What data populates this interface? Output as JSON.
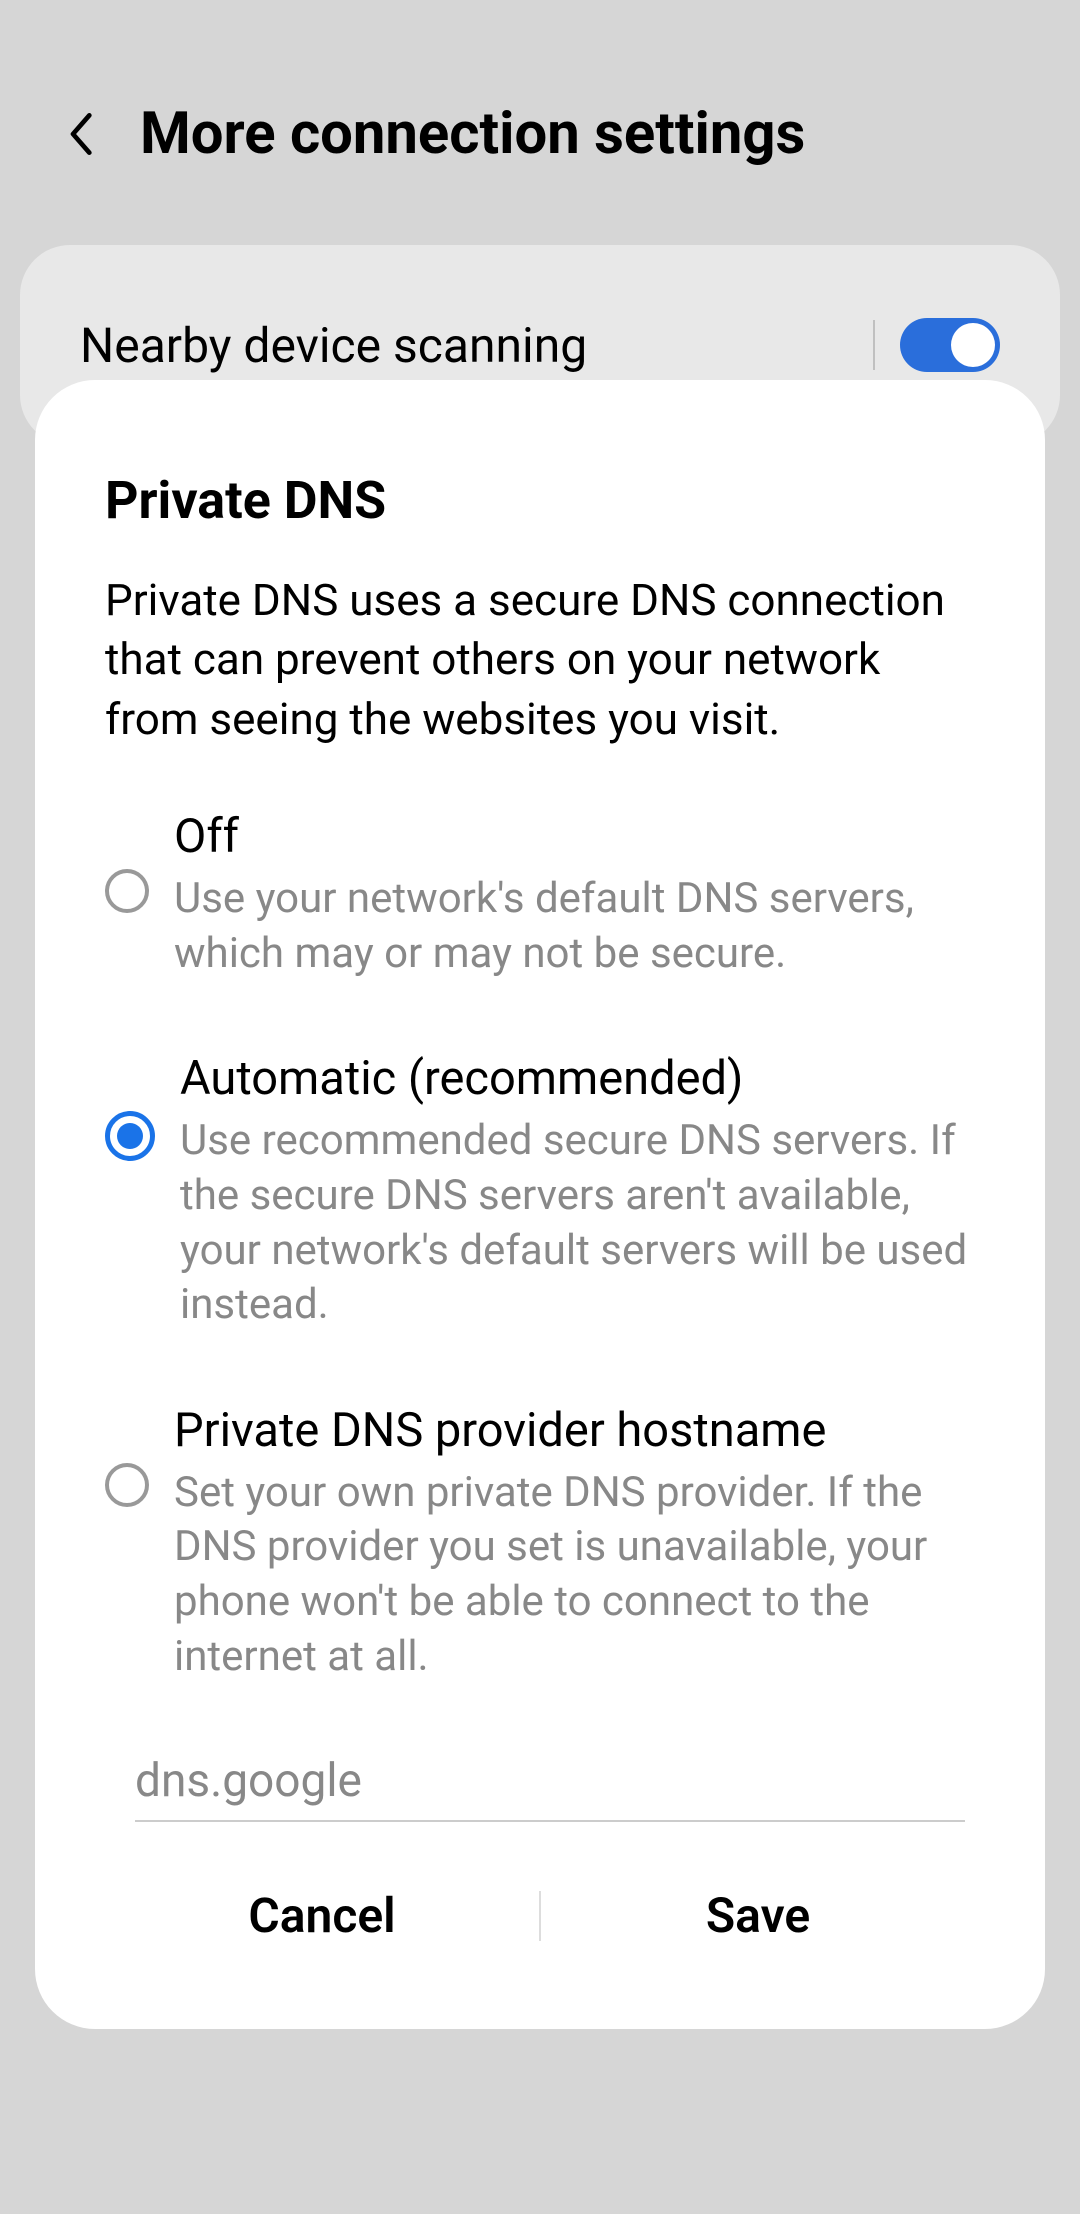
{
  "header": {
    "title": "More connection settings"
  },
  "nearby": {
    "label": "Nearby device scanning",
    "enabled": true
  },
  "dialog": {
    "title": "Private DNS",
    "description": "Private DNS uses a secure DNS connection that can prevent others on your network from seeing the websites you visit.",
    "options": [
      {
        "title": "Off",
        "description": "Use your network's default DNS servers, which may or may not be secure.",
        "selected": false
      },
      {
        "title": "Automatic (recommended)",
        "description": "Use recommended secure DNS servers. If the secure DNS servers aren't available, your network's default servers will be used instead.",
        "selected": true
      },
      {
        "title": "Private DNS provider hostname",
        "description": "Set your own private DNS provider. If the DNS provider you set is unavailable, your phone won't be able to connect to the internet at all.",
        "selected": false
      }
    ],
    "hostname_value": "dns.google",
    "cancel_label": "Cancel",
    "save_label": "Save"
  }
}
